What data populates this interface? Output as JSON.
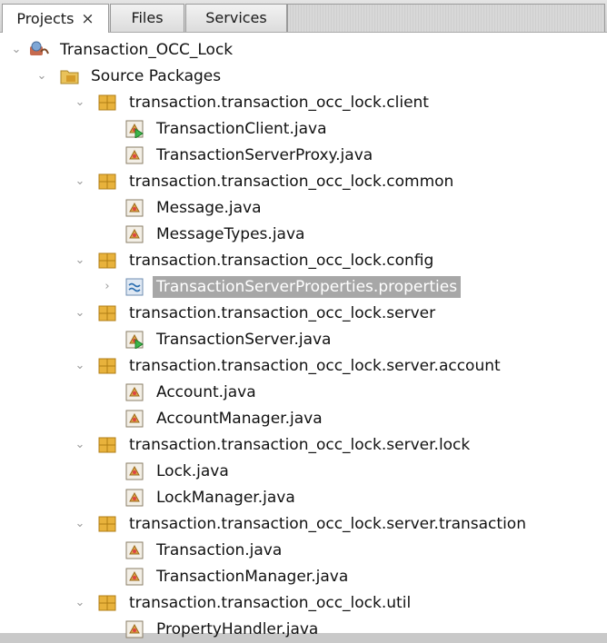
{
  "tabs": [
    {
      "label": "Projects",
      "close": "×",
      "active": true
    },
    {
      "label": "Files",
      "active": false
    },
    {
      "label": "Services",
      "active": false
    }
  ],
  "tree": {
    "project": "Transaction_OCC_Lock",
    "source_packages": "Source Packages",
    "packages": [
      {
        "name": "transaction.transaction_occ_lock.client",
        "files": [
          "TransactionClient.java",
          "TransactionServerProxy.java"
        ]
      },
      {
        "name": "transaction.transaction_occ_lock.common",
        "files": [
          "Message.java",
          "MessageTypes.java"
        ]
      },
      {
        "name": "transaction.transaction_occ_lock.config",
        "files": [
          "TransactionServerProperties.properties"
        ]
      },
      {
        "name": "transaction.transaction_occ_lock.server",
        "files": [
          "TransactionServer.java"
        ]
      },
      {
        "name": "transaction.transaction_occ_lock.server.account",
        "files": [
          "Account.java",
          "AccountManager.java"
        ]
      },
      {
        "name": "transaction.transaction_occ_lock.server.lock",
        "files": [
          "Lock.java",
          "LockManager.java"
        ]
      },
      {
        "name": "transaction.transaction_occ_lock.server.transaction",
        "files": [
          "Transaction.java",
          "TransactionManager.java"
        ]
      },
      {
        "name": "transaction.transaction_occ_lock.util",
        "files": [
          "PropertyHandler.java"
        ]
      }
    ],
    "selected_file": "TransactionServerProperties.properties"
  },
  "colors": {
    "package_icon": "#e8b23c",
    "folder_icon": "#e9c25a",
    "selection": "#a7a7a7"
  },
  "icons": {
    "twisty_expanded": "chevron-down-icon",
    "twisty_collapsed": "chevron-right-icon"
  }
}
